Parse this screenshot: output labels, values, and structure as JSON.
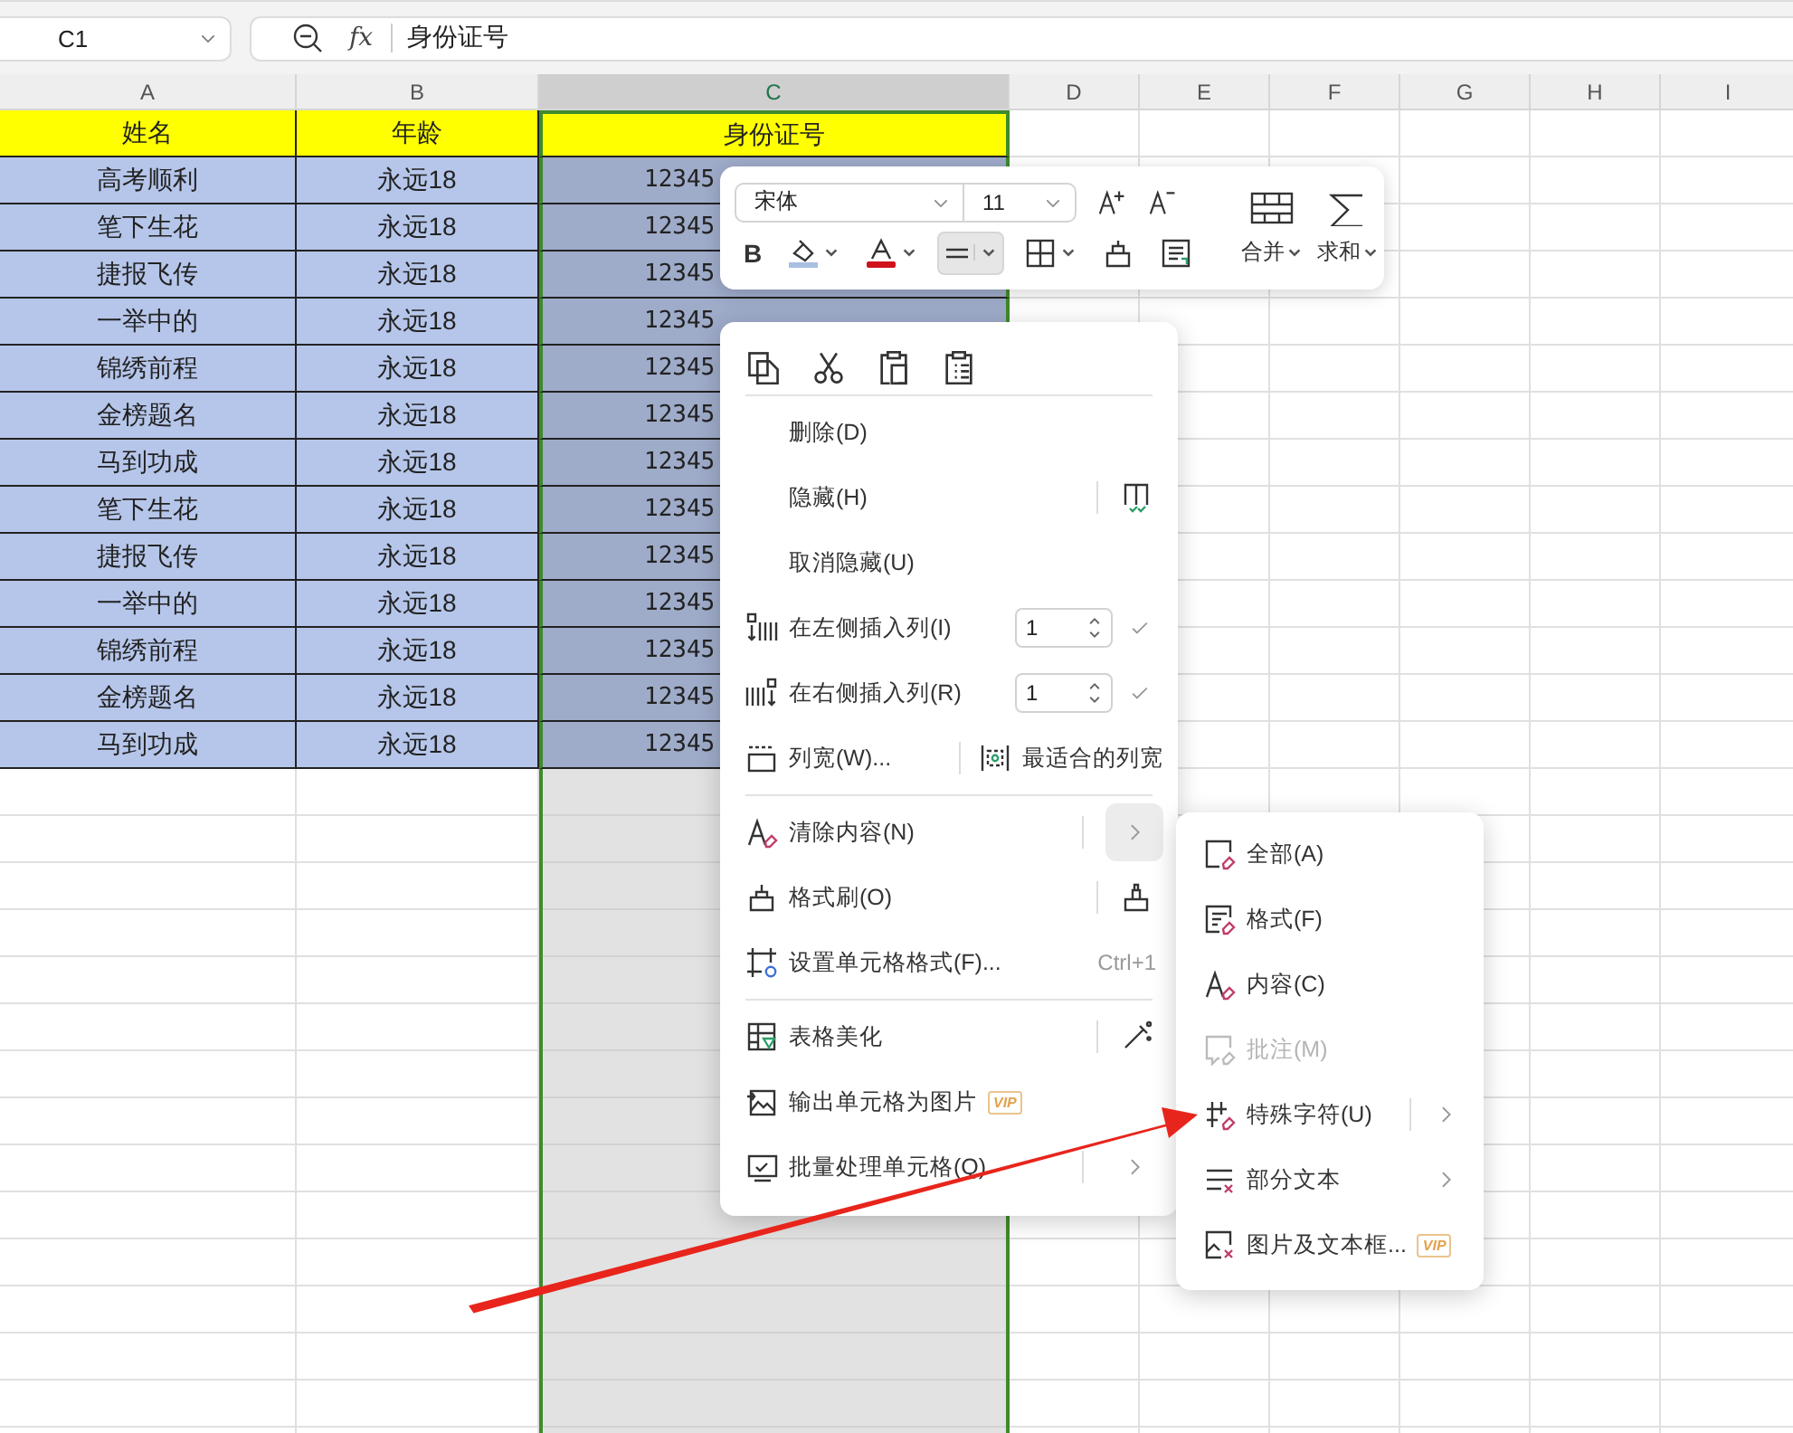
{
  "name_box": {
    "value": "C1"
  },
  "formula_bar": {
    "function_label": "fx",
    "value": "身份证号"
  },
  "columns": [
    {
      "label": "A",
      "selected": false
    },
    {
      "label": "B",
      "selected": false
    },
    {
      "label": "C",
      "selected": true
    },
    {
      "label": "D",
      "selected": false
    },
    {
      "label": "E",
      "selected": false
    },
    {
      "label": "F",
      "selected": false
    },
    {
      "label": "G",
      "selected": false
    },
    {
      "label": "H",
      "selected": false
    },
    {
      "label": "I",
      "selected": false
    }
  ],
  "header_row": [
    "姓名",
    "年龄",
    "身份证号"
  ],
  "rows": [
    {
      "name": "高考顺利",
      "age": "永远18",
      "id": "12345"
    },
    {
      "name": "笔下生花",
      "age": "永远18",
      "id": "12345"
    },
    {
      "name": "捷报飞传",
      "age": "永远18",
      "id": "12345"
    },
    {
      "name": "一举中的",
      "age": "永远18",
      "id": "12345"
    },
    {
      "name": "锦绣前程",
      "age": "永远18",
      "id": "12345"
    },
    {
      "name": "金榜题名",
      "age": "永远18",
      "id": "12345"
    },
    {
      "name": "马到功成",
      "age": "永远18",
      "id": "12345"
    },
    {
      "name": "笔下生花",
      "age": "永远18",
      "id": "12345"
    },
    {
      "name": "捷报飞传",
      "age": "永远18",
      "id": "12345"
    },
    {
      "name": "一举中的",
      "age": "永远18",
      "id": "12345"
    },
    {
      "name": "锦绣前程",
      "age": "永远18",
      "id": "12345"
    },
    {
      "name": "金榜题名",
      "age": "永远18",
      "id": "12345"
    },
    {
      "name": "马到功成",
      "age": "永远18",
      "id": "12345"
    }
  ],
  "mini_toolbar": {
    "font": "宋体",
    "size": "11",
    "merge": "合并",
    "sum": "求和",
    "format_buttons": [
      {
        "kind": "bold",
        "label": "B",
        "selected": false
      },
      {
        "kind": "fill",
        "selected": false
      },
      {
        "kind": "font-color",
        "selected": false
      },
      {
        "kind": "align",
        "selected": true
      },
      {
        "kind": "borders",
        "selected": false
      },
      {
        "kind": "brush",
        "selected": false
      },
      {
        "kind": "wrap",
        "selected": false
      }
    ]
  },
  "context_menu": {
    "groups": [
      [
        {
          "kind": "plain",
          "label": "删除(D)"
        },
        {
          "kind": "tool",
          "label": "隐藏(H)"
        },
        {
          "kind": "plain",
          "label": "取消隐藏(U)"
        },
        {
          "kind": "spin",
          "label": "在左侧插入列(I)",
          "value": "1"
        },
        {
          "kind": "spin",
          "label": "在右侧插入列(R)",
          "value": "1"
        },
        {
          "kind": "split",
          "label": "列宽(W)...",
          "extra": "最适合的列宽"
        }
      ],
      [
        {
          "kind": "submenu",
          "label": "清除内容(N)",
          "expanded": true
        },
        {
          "kind": "tool",
          "label": "格式刷(O)"
        },
        {
          "kind": "shortcut",
          "label": "设置单元格格式(F)...",
          "shortcut": "Ctrl+1"
        }
      ],
      [
        {
          "kind": "tool",
          "label": "表格美化"
        },
        {
          "kind": "badge",
          "label": "输出单元格为图片",
          "badge": "VIP"
        },
        {
          "kind": "submenu",
          "label": "批量处理单元格(Q)",
          "expanded": false
        }
      ]
    ]
  },
  "submenu": {
    "items": [
      {
        "kind": "plain",
        "label": "全部(A)",
        "disabled": false
      },
      {
        "kind": "plain",
        "label": "格式(F)",
        "disabled": false
      },
      {
        "kind": "plain",
        "label": "内容(C)",
        "disabled": false
      },
      {
        "kind": "plain",
        "label": "批注(M)",
        "disabled": true
      },
      {
        "kind": "split",
        "label": "特殊字符(U)",
        "disabled": false
      },
      {
        "kind": "submenu",
        "label": "部分文本",
        "disabled": false
      },
      {
        "kind": "badge",
        "label": "图片及文本框...",
        "badge": "VIP",
        "disabled": false
      }
    ]
  }
}
